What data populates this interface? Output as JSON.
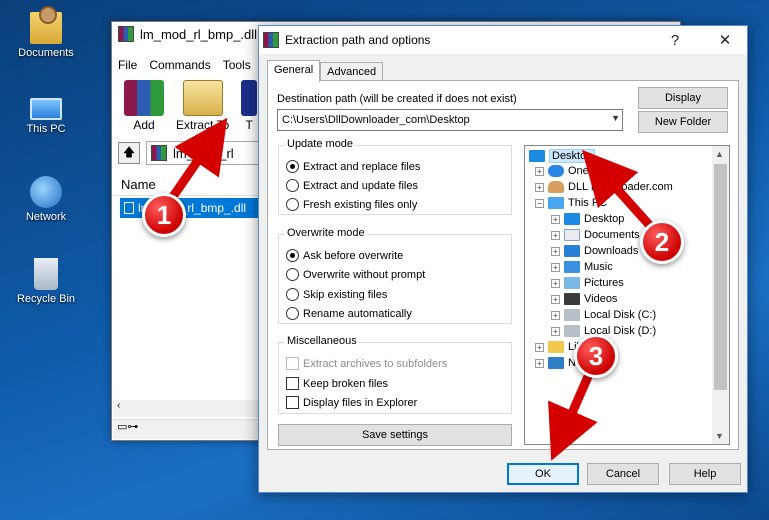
{
  "desktop": {
    "icons": [
      {
        "label": "Documents",
        "icon": "documents-folder-icon"
      },
      {
        "label": "This PC",
        "icon": "computer-icon"
      },
      {
        "label": "Network",
        "icon": "network-icon"
      },
      {
        "label": "Recycle Bin",
        "icon": "recycle-bin-icon"
      }
    ]
  },
  "winrar": {
    "title": "lm_mod_rl_bmp_.dll.zip",
    "menu": [
      "File",
      "Commands",
      "Tools"
    ],
    "tools": {
      "add": "Add",
      "extract_to": "Extract To",
      "test": "T"
    },
    "path": "lm_mod_rl",
    "column_name": "Name",
    "file_row": "lm_mod_rl_bmp_.dll"
  },
  "dialog": {
    "title": "Extraction path and options",
    "help": "?",
    "close": "✕",
    "tabs": {
      "general": "General",
      "advanced": "Advanced"
    },
    "destination_label": "Destination path (will be created if does not exist)",
    "destination_value": "C:\\Users\\DllDownloader_com\\Desktop",
    "display_button": "Display",
    "new_folder_button": "New Folder",
    "update_mode": {
      "title": "Update mode",
      "options": [
        "Extract and replace files",
        "Extract and update files",
        "Fresh existing files only"
      ],
      "selected": 0
    },
    "overwrite_mode": {
      "title": "Overwrite mode",
      "options": [
        "Ask before overwrite",
        "Overwrite without prompt",
        "Skip existing files",
        "Rename automatically"
      ],
      "selected": 0
    },
    "misc": {
      "title": "Miscellaneous",
      "options": [
        "Extract archives to subfolders",
        "Keep broken files",
        "Display files in Explorer"
      ]
    },
    "save_settings": "Save settings",
    "tree": {
      "desktop": "Desktop",
      "onedrive": "OneDrive",
      "user": "DLL Downloader.com",
      "this_pc": "This PC",
      "pc_desktop": "Desktop",
      "documents": "Documents",
      "downloads": "Downloads",
      "music": "Music",
      "pictures": "Pictures",
      "videos": "Videos",
      "disk_c": "Local Disk (C:)",
      "disk_d": "Local Disk (D:)",
      "libraries": "Libraries",
      "network": "Network"
    },
    "ok": "OK",
    "cancel": "Cancel",
    "help_button": "Help"
  },
  "annotations": {
    "step1": "1",
    "step2": "2",
    "step3": "3",
    "accent": "#d40000"
  }
}
